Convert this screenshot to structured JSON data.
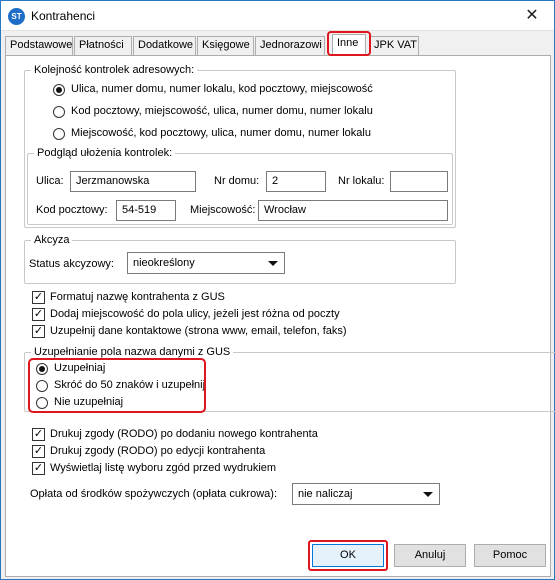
{
  "window": {
    "title": "Kontrahenci",
    "app_icon": "app-logo-icon",
    "close_glyph": "✕"
  },
  "tabs": [
    {
      "label": "Podstawowe"
    },
    {
      "label": "Płatności"
    },
    {
      "label": "Dodatkowe"
    },
    {
      "label": "Księgowe"
    },
    {
      "label": "Jednorazowi"
    },
    {
      "label": "Inne",
      "active": true
    },
    {
      "label": "JPK VAT"
    }
  ],
  "address_order": {
    "legend": "Kolejność kontrolek adresowych:",
    "options": [
      {
        "label": "Ulica, numer domu, numer lokalu, kod pocztowy, miejscowość",
        "selected": true
      },
      {
        "label": "Kod pocztowy, miejscowość, ulica, numer domu, numer lokalu",
        "selected": false
      },
      {
        "label": "Miejscowość, kod pocztowy, ulica, numer domu, numer lokalu",
        "selected": false
      }
    ],
    "preview": {
      "legend": "Podgląd ułożenia kontrolek:",
      "street_label": "Ulica:",
      "street_value": "Jerzmanowska",
      "house_label": "Nr domu:",
      "house_value": "2",
      "apt_label": "Nr lokalu:",
      "apt_value": "",
      "postal_label": "Kod pocztowy:",
      "postal_value": "54-519",
      "city_label": "Miejscowość:",
      "city_value": "Wrocław"
    }
  },
  "excise": {
    "legend": "Akcyza",
    "status_label": "Status akcyzowy:",
    "status_value": "nieokreślony"
  },
  "gus_options": [
    {
      "label": "Formatuj nazwę kontrahenta z GUS",
      "checked": true
    },
    {
      "label": "Dodaj miejscowość do pola ulicy, jeżeli jest różna od poczty",
      "checked": true
    },
    {
      "label": "Uzupełnij dane kontaktowe (strona www, email, telefon, faks)",
      "checked": true
    }
  ],
  "gus_name": {
    "legend": "Uzupełnianie pola nazwa danymi z GUS",
    "options": [
      {
        "label": "Uzupełniaj",
        "selected": true
      },
      {
        "label": "Skróć do 50 znaków i uzupełnij",
        "selected": false
      },
      {
        "label": "Nie uzupełniaj",
        "selected": false
      }
    ]
  },
  "rodo_options": [
    {
      "label": "Drukuj zgody (RODO) po dodaniu nowego kontrahenta",
      "checked": true
    },
    {
      "label": "Drukuj zgody (RODO) po edycji kontrahenta",
      "checked": true
    },
    {
      "label": "Wyświetlaj listę wyboru zgód przed wydrukiem",
      "checked": true
    }
  ],
  "sugar_fee": {
    "label": "Opłata od środków spożywczych (opłata cukrowa):",
    "value": "nie naliczaj"
  },
  "buttons": {
    "ok": "OK",
    "cancel": "Anuluj",
    "help": "Pomoc"
  },
  "colors": {
    "highlight": "#e0161e",
    "accent": "#2b78c2"
  }
}
